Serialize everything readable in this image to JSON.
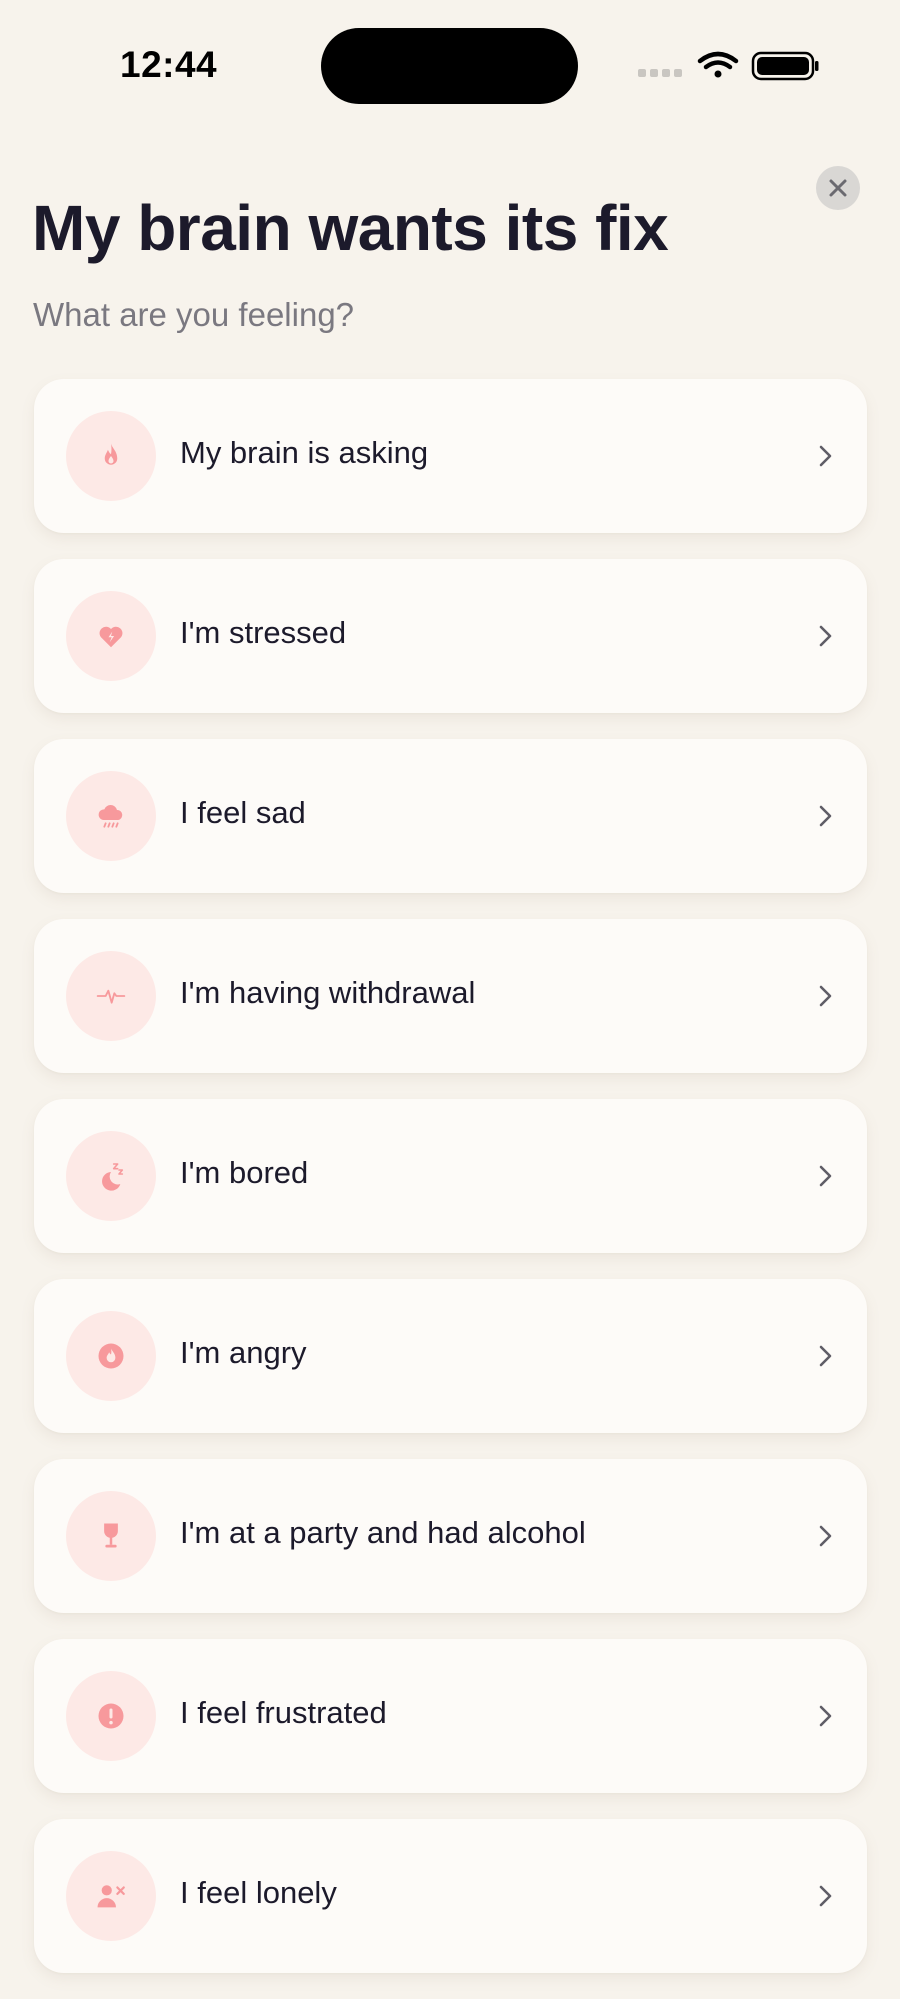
{
  "status_bar": {
    "time": "12:44"
  },
  "header": {
    "title": "My brain wants its fix",
    "subtitle": "What are you feeling?"
  },
  "colors": {
    "background": "#f7f3ec",
    "card": "#fdfbf8",
    "icon_bg": "#fde9e6",
    "icon": "#f7999c",
    "text": "#1c1a2b",
    "subtitle": "#7a7880"
  },
  "feelings": [
    {
      "label": "My brain is asking",
      "icon": "flame-icon"
    },
    {
      "label": "I'm stressed",
      "icon": "heart-bolt-icon"
    },
    {
      "label": "I feel sad",
      "icon": "rain-cloud-icon"
    },
    {
      "label": "I'm having withdrawal",
      "icon": "pulse-icon"
    },
    {
      "label": "I'm bored",
      "icon": "moon-zzz-icon"
    },
    {
      "label": "I'm angry",
      "icon": "flame-circle-icon"
    },
    {
      "label": "I'm at a party and had alcohol",
      "icon": "wine-glass-icon"
    },
    {
      "label": "I feel frustrated",
      "icon": "alert-circle-icon"
    },
    {
      "label": "I feel lonely",
      "icon": "person-x-icon"
    }
  ]
}
